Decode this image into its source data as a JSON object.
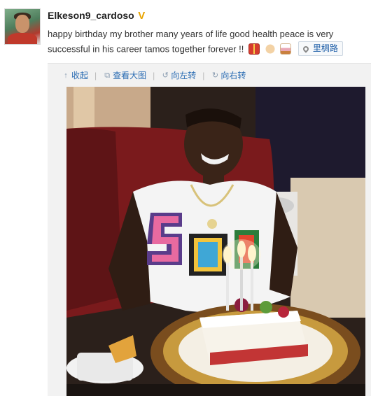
{
  "post": {
    "username": "Elkeson9_cardoso",
    "verified_badge": "V",
    "text": "happy birthday my brother many years of life good health peace is very successful in his career tamos together forever !!",
    "emoticons": [
      "gift-emoji",
      "clap-emoji",
      "cake-emoji"
    ],
    "location_label": "里稠路"
  },
  "media_toolbar": {
    "collapse_label": "收起",
    "view_large_label": "查看大图",
    "rotate_left_label": "向左转",
    "rotate_right_label": "向右转"
  },
  "colors": {
    "link_blue": "#2a6cb3",
    "badge_gold": "#e8a400",
    "media_bg": "#f2f2f2"
  }
}
